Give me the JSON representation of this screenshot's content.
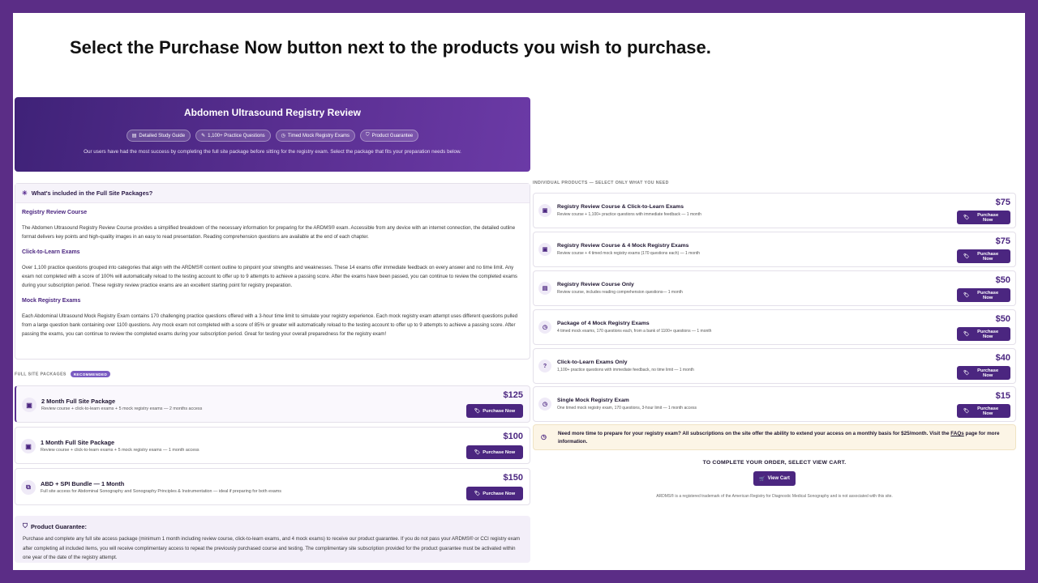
{
  "instruction": "Select the Purchase Now button next to the products you wish to purchase.",
  "hero": {
    "title": "Abdomen Ultrasound Registry Review",
    "chips": [
      "Detailed Study Guide",
      "1,100+ Practice Questions",
      "Timed Mock Registry Exams",
      "Product Guarantee"
    ],
    "subtitle": "Our users have had the most success by completing the full site package before sitting for the registry exam. Select the package that fits your preparation needs below."
  },
  "details": {
    "heading": "What's included in the Full Site Packages?",
    "sections": [
      {
        "title": "Registry Review Course",
        "text": "The Abdomen Ultrasound Registry Review Course provides a simplified breakdown of the necessary information for preparing for the ARDMS® exam. Accessible from any device with an internet connection, the detailed outline format delivers key points and high-quality images in an easy to read presentation. Reading comprehension questions are available at the end of each chapter."
      },
      {
        "title": "Click-to-Learn Exams",
        "text": "Over 1,100 practice questions grouped into categories that align with the ARDMS® content outline to pinpoint your strengths and weaknesses. These 14 exams offer immediate feedback on every answer and no time limit. Any exam not completed with a score of 100% will automatically reload to the testing account to offer up to 9 attempts to achieve a passing score. After the exams have been passed, you can continue to review the completed exams during your subscription period. These registry review practice exams are an excellent starting point for registry preparation."
      },
      {
        "title": "Mock Registry Exams",
        "text": "Each Abdominal Ultrasound Mock Registry Exam contains 170 challenging practice questions offered with a 3-hour time limit to simulate your registry experience. Each mock registry exam attempt uses different questions pulled from a large question bank containing over 1100 questions. Any mock exam not completed with a score of 85% or greater will automatically reload to the testing account to offer up to 9 attempts to achieve a passing score. After passing the exams, you can continue to review the completed exams during your subscription period. Great for testing your overall preparedness for the registry exam!"
      }
    ]
  },
  "full_site": {
    "label": "FULL SITE PACKAGES",
    "badge": "RECOMMENDED",
    "packages": [
      {
        "name": "2 Month Full Site Package",
        "desc": "Review course + click-to-learn exams + 5 mock registry exams — 2 months access",
        "price": "$125",
        "button": "Purchase Now",
        "icon": "bundle-icon"
      },
      {
        "name": "1 Month Full Site Package",
        "desc": "Review course + click-to-learn exams + 5 mock registry exams — 1 month access",
        "price": "$100",
        "button": "Purchase Now",
        "icon": "bundle-icon"
      },
      {
        "name": "ABD + SPI Bundle — 1 Month",
        "desc": "Full site access for Abdominal Sonography and Sonography Principles & Instrumentation — ideal if preparing for both exams",
        "price": "$150",
        "button": "Purchase Now",
        "icon": "copy-icon"
      }
    ]
  },
  "guarantee": {
    "title": "Product Guarantee:",
    "text": "Purchase and complete any full site access package (minimum 1 month including review course, click-to-learn exams, and 4 mock exams) to receive our product guarantee. If you do not pass your ARDMS® or CCI registry exam after completing all included items, you will receive complimentary access to repeat the previously purchased course and testing. The complimentary site subscription provided for the product guarantee must be activated within one year of the date of the registry attempt."
  },
  "individual": {
    "label": "INDIVIDUAL PRODUCTS — SELECT ONLY WHAT YOU NEED",
    "products": [
      {
        "name": "Registry Review Course & Click-to-Learn Exams",
        "desc": "Review course + 1,100+ practice questions with immediate feedback — 1 month",
        "price": "$75",
        "button": "Purchase Now",
        "icon": "bundle-icon"
      },
      {
        "name": "Registry Review Course & 4 Mock Registry Exams",
        "desc": "Review course + 4 timed mock registry exams (170 questions each) — 1 month",
        "price": "$75",
        "button": "Purchase Now",
        "icon": "bundle-icon"
      },
      {
        "name": "Registry Review Course Only",
        "desc": "Review course, includes reading comprehension questions— 1 month",
        "price": "$50",
        "button": "Purchase Now",
        "icon": "book-icon"
      },
      {
        "name": "Package of 4 Mock Registry Exams",
        "desc": "4 timed mock exams, 170 questions each, from a bank of 1100+ questions — 1 month",
        "price": "$50",
        "button": "Purchase Now",
        "icon": "timer-icon"
      },
      {
        "name": "Click-to-Learn Exams Only",
        "desc": "1,100+ practice questions with immediate feedback, no time limit — 1 month",
        "price": "$40",
        "button": "Purchase Now",
        "icon": "question-icon"
      },
      {
        "name": "Single Mock Registry Exam",
        "desc": "One timed mock registry exam, 170 questions, 3-hour limit — 1 month access",
        "price": "$15",
        "button": "Purchase Now",
        "icon": "timer-icon"
      }
    ]
  },
  "notice": {
    "text": "Need more time to prepare for your registry exam? All subscriptions on the site offer the ability to extend your access on a monthly basis for $25/month. Visit the ",
    "link": "FAQs",
    "after": " page for more information."
  },
  "checkout": {
    "label": "TO COMPLETE YOUR ORDER, SELECT VIEW CART.",
    "button": "View Cart"
  },
  "trademark": "ARDMS® is a registered trademark of the American Registry for Diagnostic Medical Sonography and is not associated with this site.",
  "colors": {
    "frame": "#5b2d86",
    "accent": "#4b2680",
    "notice_bg": "#fcf5e6"
  }
}
